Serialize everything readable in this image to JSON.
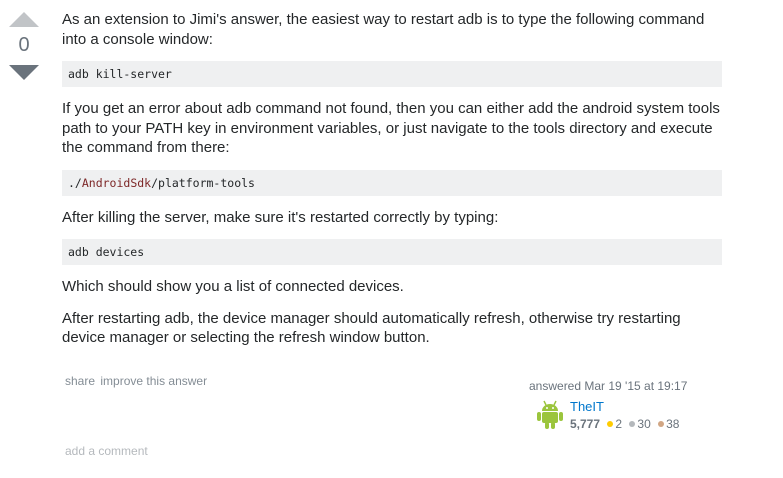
{
  "vote": {
    "count": "0"
  },
  "post": {
    "p1": "As an extension to Jimi's answer, the easiest way to restart adb is to type the following command into a console window:",
    "code1": "adb kill-server",
    "p2": "If you get an error about adb command not found, then you can either add the android system tools path to your PATH key in environment variables, or just navigate to the tools directory and execute the command from there:",
    "code2_prefix": "./",
    "code2_path": "AndroidSdk",
    "code2_suffix": "/platform-tools",
    "p3": "After killing the server, make sure it's restarted correctly by typing:",
    "code3": "adb devices",
    "p4": "Which should show you a list of connected devices.",
    "p5": "After restarting adb, the device manager should automatically refresh, otherwise try restarting device manager or selecting the refresh window button."
  },
  "menu": {
    "share": "share",
    "improve": "improve this answer"
  },
  "user": {
    "action": "answered Mar 19 '15 at 19:17",
    "name": "TheIT",
    "reputation": "5,777",
    "gold": "2",
    "silver": "30",
    "bronze": "38",
    "avatar_icon": "android-avatar-icon"
  },
  "comment": {
    "add_label": "add a comment"
  },
  "colors": {
    "link": "#0077cc",
    "muted": "#848d95",
    "code_bg": "#eff0f1",
    "gold": "#ffcc01",
    "silver": "#b4b8bc",
    "bronze": "#d1a684"
  }
}
